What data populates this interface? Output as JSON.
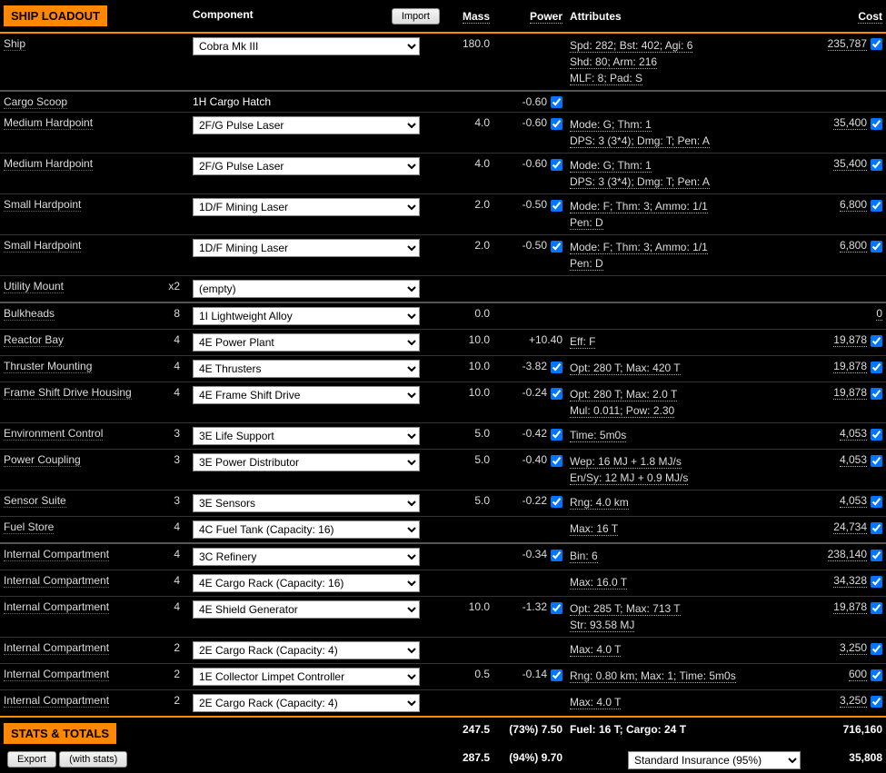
{
  "headers": {
    "section": "SHIP LOADOUT",
    "component": "Component",
    "import": "Import",
    "mass": "Mass",
    "power": "Power",
    "attributes": "Attributes",
    "cost": "Cost",
    "stats": "STATS & TOTALS",
    "export": "Export",
    "withstats": "(with stats)"
  },
  "rows": [
    {
      "slot": "Ship",
      "qty": "",
      "comp": "Cobra Mk III",
      "static": false,
      "mass": "180.0",
      "power": "",
      "pchk": false,
      "attr": "Spd: 282; Bst: 402; Agi: 6\nShd: 80; Arm: 216\nMLF: 8; Pad: S",
      "cost": "235,787",
      "cchk": true,
      "sep": true
    },
    {
      "slot": "Cargo Scoop",
      "qty": "",
      "comp": "1H Cargo Hatch",
      "static": true,
      "mass": "",
      "power": "-0.60",
      "pchk": true,
      "attr": "",
      "cost": "",
      "cchk": false,
      "sep": false
    },
    {
      "slot": "Medium Hardpoint",
      "qty": "",
      "comp": "2F/G Pulse Laser",
      "static": false,
      "mass": "4.0",
      "power": "-0.60",
      "pchk": true,
      "attr": "Mode: G; Thm: 1\nDPS: 3 (3*4); Dmg: T; Pen: A",
      "cost": "35,400",
      "cchk": true,
      "sep": false
    },
    {
      "slot": "Medium Hardpoint",
      "qty": "",
      "comp": "2F/G Pulse Laser",
      "static": false,
      "mass": "4.0",
      "power": "-0.60",
      "pchk": true,
      "attr": "Mode: G; Thm: 1\nDPS: 3 (3*4); Dmg: T; Pen: A",
      "cost": "35,400",
      "cchk": true,
      "sep": false
    },
    {
      "slot": "Small Hardpoint",
      "qty": "",
      "comp": "1D/F Mining Laser",
      "static": false,
      "mass": "2.0",
      "power": "-0.50",
      "pchk": true,
      "attr": "Mode: F; Thm: 3; Ammo: 1/1\nPen: D",
      "cost": "6,800",
      "cchk": true,
      "sep": false
    },
    {
      "slot": "Small Hardpoint",
      "qty": "",
      "comp": "1D/F Mining Laser",
      "static": false,
      "mass": "2.0",
      "power": "-0.50",
      "pchk": true,
      "attr": "Mode: F; Thm: 3; Ammo: 1/1\nPen: D",
      "cost": "6,800",
      "cchk": true,
      "sep": false
    },
    {
      "slot": "Utility Mount",
      "qty": "x2",
      "comp": "(empty)",
      "static": false,
      "mass": "",
      "power": "",
      "pchk": false,
      "attr": "",
      "cost": "",
      "cchk": false,
      "sep": true
    },
    {
      "slot": "Bulkheads",
      "qty": "8",
      "comp": "1I Lightweight Alloy",
      "static": false,
      "mass": "0.0",
      "power": "",
      "pchk": false,
      "attr": "",
      "cost": "0",
      "cchk": false,
      "sep": false
    },
    {
      "slot": "Reactor Bay",
      "qty": "4",
      "comp": "4E Power Plant",
      "static": false,
      "mass": "10.0",
      "power": "+10.40",
      "pchk": false,
      "attr": "Eff: F",
      "cost": "19,878",
      "cchk": true,
      "sep": false
    },
    {
      "slot": "Thruster Mounting",
      "qty": "4",
      "comp": "4E Thrusters",
      "static": false,
      "mass": "10.0",
      "power": "-3.82",
      "pchk": true,
      "attr": "Opt: 280 T; Max: 420 T",
      "cost": "19,878",
      "cchk": true,
      "sep": false
    },
    {
      "slot": "Frame Shift Drive Housing",
      "qty": "4",
      "comp": "4E Frame Shift Drive",
      "static": false,
      "mass": "10.0",
      "power": "-0.24",
      "pchk": true,
      "attr": "Opt: 280 T; Max: 2.0 T\nMul: 0.011; Pow: 2.30",
      "cost": "19,878",
      "cchk": true,
      "sep": false
    },
    {
      "slot": "Environment Control",
      "qty": "3",
      "comp": "3E Life Support",
      "static": false,
      "mass": "5.0",
      "power": "-0.42",
      "pchk": true,
      "attr": "Time: 5m0s",
      "cost": "4,053",
      "cchk": true,
      "sep": false
    },
    {
      "slot": "Power Coupling",
      "qty": "3",
      "comp": "3E Power Distributor",
      "static": false,
      "mass": "5.0",
      "power": "-0.40",
      "pchk": true,
      "attr": "Wep: 16 MJ + 1.8 MJ/s\nEn/Sy: 12 MJ + 0.9 MJ/s",
      "cost": "4,053",
      "cchk": true,
      "sep": false
    },
    {
      "slot": "Sensor Suite",
      "qty": "3",
      "comp": "3E Sensors",
      "static": false,
      "mass": "5.0",
      "power": "-0.22",
      "pchk": true,
      "attr": "Rng: 4.0 km",
      "cost": "4,053",
      "cchk": true,
      "sep": false
    },
    {
      "slot": "Fuel Store",
      "qty": "4",
      "comp": "4C Fuel Tank (Capacity: 16)",
      "static": false,
      "mass": "",
      "power": "",
      "pchk": false,
      "attr": "Max: 16 T",
      "cost": "24,734",
      "cchk": true,
      "sep": true
    },
    {
      "slot": "Internal Compartment",
      "qty": "4",
      "comp": "3C Refinery",
      "static": false,
      "mass": "",
      "power": "-0.34",
      "pchk": true,
      "attr": "Bin: 6",
      "cost": "238,140",
      "cchk": true,
      "sep": false
    },
    {
      "slot": "Internal Compartment",
      "qty": "4",
      "comp": "4E Cargo Rack (Capacity: 16)",
      "static": false,
      "mass": "",
      "power": "",
      "pchk": false,
      "attr": "Max: 16.0 T",
      "cost": "34,328",
      "cchk": true,
      "sep": false
    },
    {
      "slot": "Internal Compartment",
      "qty": "4",
      "comp": "4E Shield Generator",
      "static": false,
      "mass": "10.0",
      "power": "-1.32",
      "pchk": true,
      "attr": "Opt: 285 T; Max: 713 T\nStr: 93.58 MJ",
      "cost": "19,878",
      "cchk": true,
      "sep": false
    },
    {
      "slot": "Internal Compartment",
      "qty": "2",
      "comp": "2E Cargo Rack (Capacity: 4)",
      "static": false,
      "mass": "",
      "power": "",
      "pchk": false,
      "attr": "Max: 4.0 T",
      "cost": "3,250",
      "cchk": true,
      "sep": false
    },
    {
      "slot": "Internal Compartment",
      "qty": "2",
      "comp": "1E Collector Limpet Controller",
      "static": false,
      "mass": "0.5",
      "power": "-0.14",
      "pchk": true,
      "attr": "Rng: 0.80 km; Max: 1; Time: 5m0s",
      "cost": "600",
      "cchk": true,
      "sep": false
    },
    {
      "slot": "Internal Compartment",
      "qty": "2",
      "comp": "2E Cargo Rack (Capacity: 4)",
      "static": false,
      "mass": "",
      "power": "",
      "pchk": false,
      "attr": "Max: 4.0 T",
      "cost": "3,250",
      "cchk": true,
      "sep": false
    }
  ],
  "totals": {
    "mass1": "247.5",
    "power1": "(73%) 7.50",
    "attr1": "Fuel: 16 T; Cargo: 24 T",
    "cost1": "716,160",
    "mass2": "287.5",
    "power2": "(94%) 9.70",
    "insurance": "Standard Insurance (95%)",
    "cost2": "35,808"
  }
}
